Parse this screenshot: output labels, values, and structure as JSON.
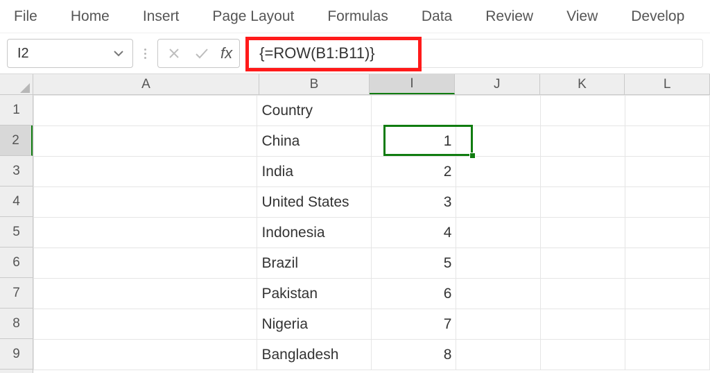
{
  "ribbon": {
    "tabs": [
      "File",
      "Home",
      "Insert",
      "Page Layout",
      "Formulas",
      "Data",
      "Review",
      "View",
      "Develop"
    ]
  },
  "formula_bar": {
    "name_box_value": "I2",
    "fx_label": "fx",
    "formula_text": "{=ROW(B1:B11)}"
  },
  "columns": [
    {
      "key": "A",
      "label": "A",
      "class": "ch-A",
      "selected": false
    },
    {
      "key": "B",
      "label": "B",
      "class": "ch-B",
      "selected": false
    },
    {
      "key": "I",
      "label": "I",
      "class": "ch-I",
      "selected": true
    },
    {
      "key": "J",
      "label": "J",
      "class": "ch-J",
      "selected": false
    },
    {
      "key": "K",
      "label": "K",
      "class": "ch-K",
      "selected": false
    },
    {
      "key": "L",
      "label": "L",
      "class": "ch-L",
      "selected": false
    }
  ],
  "rows": [
    {
      "num": "1",
      "selected": false
    },
    {
      "num": "2",
      "selected": true
    },
    {
      "num": "3",
      "selected": false
    },
    {
      "num": "4",
      "selected": false
    },
    {
      "num": "5",
      "selected": false
    },
    {
      "num": "6",
      "selected": false
    },
    {
      "num": "7",
      "selected": false
    },
    {
      "num": "8",
      "selected": false
    },
    {
      "num": "9",
      "selected": false
    }
  ],
  "cells": {
    "B": [
      "Country",
      "China",
      "India",
      "United States",
      "Indonesia",
      "Brazil",
      "Pakistan",
      "Nigeria",
      "Bangladesh"
    ],
    "I": [
      "",
      "1",
      "2",
      "3",
      "4",
      "5",
      "6",
      "7",
      "8"
    ]
  },
  "selection": {
    "active_cell": "I2",
    "row_index": 1,
    "col_key": "I"
  }
}
